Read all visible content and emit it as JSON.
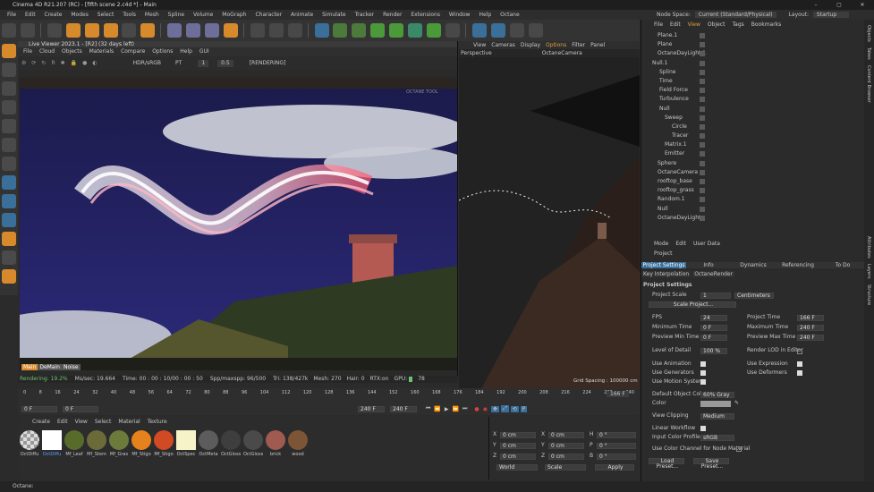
{
  "window": {
    "title": "Cinema 4D R21.207 (RC) - [fifth scene 2.c4d *] - Main"
  },
  "menu": [
    "File",
    "Edit",
    "Create",
    "Modes",
    "Select",
    "Tools",
    "Mesh",
    "Spline",
    "Volume",
    "MoGraph",
    "Character",
    "Animate",
    "Simulate",
    "Tracker",
    "Render",
    "Extensions",
    "Window",
    "Help",
    "Octane"
  ],
  "node_space": {
    "label": "Node Space:",
    "value": "Current (Standard/Physical)"
  },
  "layout": {
    "label": "Layout:",
    "value": "Startup"
  },
  "live_viewer": {
    "title": "Live Viewer 2023.1 - [R2] (32 days left)",
    "menu": [
      "File",
      "Cloud",
      "Objects",
      "Materials",
      "Compare",
      "Options",
      "Help",
      "GUI"
    ],
    "color_space": "HDR/sRGB",
    "mode": "PT",
    "num1": "1",
    "num2": "0.5",
    "status_label": "[RENDERING]",
    "corner_text": "OCTANE TOOL",
    "overlay_buttons": [
      "Main",
      "DeMain",
      "Noise"
    ],
    "stats": {
      "rendering": "Rendering: 19.2%",
      "ms_sec": "Ms/sec: 19.664",
      "time": "Time: 00 : 00 : 10/00 : 00 : 50",
      "spp": "Spp/maxspp: 96/500",
      "tri": "Tri: 138/427k",
      "mesh": "Mesh: 270",
      "hair": "Hair: 0",
      "rtx": "RTX:on",
      "gpu": "GPU:",
      "gpu_val": "78"
    }
  },
  "viewport": {
    "menu": [
      "View",
      "Cameras",
      "Display",
      "Options",
      "Filter",
      "Panel"
    ],
    "projection": "Perspective",
    "camera": "OctaneCamera",
    "grid": "Grid Spacing : 100000 cm"
  },
  "timeline": {
    "ticks": [
      "0",
      "8",
      "16",
      "24",
      "32",
      "40",
      "48",
      "56",
      "64",
      "72",
      "80",
      "88",
      "96",
      "104",
      "112",
      "120",
      "128",
      "136",
      "144",
      "152",
      "160",
      "168",
      "176",
      "184",
      "192",
      "200",
      "208",
      "216",
      "224",
      "232",
      "240"
    ],
    "end_frame": "166 F",
    "current": "0 F",
    "start": "0 F",
    "max1": "240 F",
    "max2": "240 F"
  },
  "materials": {
    "menu": [
      "Create",
      "Edit",
      "View",
      "Select",
      "Material",
      "Texture"
    ],
    "items": [
      {
        "name": "OctDiffu",
        "color": "#dcdcdc"
      },
      {
        "name": "OctDiffu",
        "color": "#ffffff"
      },
      {
        "name": "Mf_Leaf",
        "color": "#596b2b"
      },
      {
        "name": "Mf_Stem",
        "color": "#6b6b3a"
      },
      {
        "name": "Mf_Gras",
        "color": "#6c7a3c"
      },
      {
        "name": "Mf_Stigo",
        "color": "#e6821e"
      },
      {
        "name": "Mf_Stigo",
        "color": "#d04a24"
      },
      {
        "name": "OctSpec",
        "color": "#f6f3c8"
      },
      {
        "name": "OctMeta",
        "color": "#5c5c5c"
      },
      {
        "name": "OctGloss",
        "color": "#3e3e3e"
      },
      {
        "name": "OctGloss",
        "color": "#4a4a4a"
      },
      {
        "name": "brick",
        "color": "#a05a50"
      },
      {
        "name": "wood",
        "color": "#7b5536"
      }
    ]
  },
  "coords": {
    "labels": [
      "X",
      "Y",
      "Z"
    ],
    "pos": [
      "0 cm",
      "0 cm",
      "0 cm"
    ],
    "size": [
      "0 cm",
      "0 cm",
      "0 cm"
    ],
    "rot": [
      "H",
      "P",
      "B"
    ],
    "rot_vals": [
      "0 °",
      "0 °",
      "0 °"
    ],
    "mode1": "World",
    "mode2": "Scale",
    "apply": "Apply"
  },
  "object_manager": {
    "menu": [
      "File",
      "Edit",
      "View",
      "Object",
      "Tags",
      "Bookmarks"
    ],
    "objects": [
      {
        "name": "Plane.1",
        "indent": 1
      },
      {
        "name": "Plane",
        "indent": 1
      },
      {
        "name": "OctaneDayLight.1",
        "indent": 1
      },
      {
        "name": "Null.1",
        "indent": 0
      },
      {
        "name": "Spline",
        "indent": 1
      },
      {
        "name": "Time",
        "indent": 1
      },
      {
        "name": "Field Force",
        "indent": 1
      },
      {
        "name": "Turbulence",
        "indent": 1
      },
      {
        "name": "Null",
        "indent": 1
      },
      {
        "name": "Sweep",
        "indent": 2
      },
      {
        "name": "Circle",
        "indent": 3
      },
      {
        "name": "Tracer",
        "indent": 3
      },
      {
        "name": "Matrix.1",
        "indent": 2
      },
      {
        "name": "Emitter",
        "indent": 2
      },
      {
        "name": "Sphere",
        "indent": 1
      },
      {
        "name": "OctaneCamera",
        "indent": 1
      },
      {
        "name": "rooftop_base",
        "indent": 1
      },
      {
        "name": "rooftop_grass",
        "indent": 1
      },
      {
        "name": "Random.1",
        "indent": 1
      },
      {
        "name": "Null",
        "indent": 1
      },
      {
        "name": "OctaneDayLight",
        "indent": 1
      }
    ]
  },
  "attributes": {
    "menu": [
      "Mode",
      "Edit",
      "User Data"
    ],
    "object": "Project",
    "tabs": [
      "Project Settings",
      "Info",
      "Dynamics",
      "Referencing",
      "To Do"
    ],
    "subtabs": [
      "Key Interpolation",
      "OctaneRender"
    ],
    "section": "Project Settings",
    "project_scale_label": "Project Scale",
    "project_scale": "1",
    "scale_unit": "Centimeters",
    "scale_project_btn": "Scale Project...",
    "fps_label": "FPS",
    "fps": "24",
    "project_time_label": "Project Time",
    "project_time": "166 F",
    "min_time_label": "Minimum Time",
    "min_time": "0 F",
    "max_time_label": "Maximum Time",
    "max_time": "240 F",
    "prev_min_label": "Preview Min Time",
    "prev_min": "0 F",
    "prev_max_label": "Preview Max Time",
    "prev_max": "240 F",
    "lod_label": "Level of Detail",
    "lod": "100 %",
    "render_lod_label": "Render LOD in Editor",
    "use_anim": "Use Animation",
    "use_expr": "Use Expression",
    "use_gen": "Use Generators",
    "use_def": "Use Deformers",
    "use_motion": "Use Motion System",
    "def_color_label": "Default Object Color",
    "def_color": "60% Gray",
    "color_label": "Color",
    "view_clip_label": "View Clipping",
    "view_clip": "Medium",
    "linear_label": "Linear Workflow",
    "input_profile_label": "Input Color Profile",
    "input_profile": "sRGB",
    "use_color_channel": "Use Color Channel for Node Material",
    "load_preset": "Load Preset...",
    "save_preset": "Save Preset..."
  },
  "right_tabs": [
    "Objects",
    "Takes",
    "Content Browser",
    "Attributes",
    "Layers",
    "Structure"
  ],
  "status": "Octane:"
}
